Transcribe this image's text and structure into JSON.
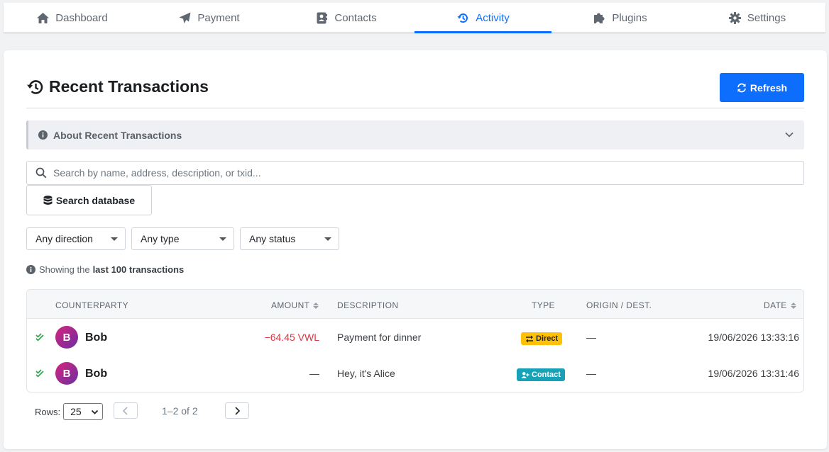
{
  "nav": {
    "tabs": [
      {
        "label": "Dashboard",
        "icon": "home-icon"
      },
      {
        "label": "Payment",
        "icon": "paper-plane-icon"
      },
      {
        "label": "Contacts",
        "icon": "address-book-icon"
      },
      {
        "label": "Activity",
        "icon": "history-icon",
        "active": true
      },
      {
        "label": "Plugins",
        "icon": "puzzle-icon"
      },
      {
        "label": "Settings",
        "icon": "gear-icon"
      }
    ]
  },
  "page": {
    "title": "Recent Transactions",
    "refresh_label": "Refresh",
    "about_label": "About Recent Transactions",
    "search_placeholder": "Search by name, address, description, or txid...",
    "search_db_label": "Search database",
    "filters": {
      "direction": "Any direction",
      "type": "Any type",
      "status": "Any status"
    },
    "showing_prefix": "Showing the",
    "showing_bold": "last 100 transactions"
  },
  "table": {
    "headers": {
      "counterparty": "COUNTERPARTY",
      "amount": "AMOUNT",
      "description": "DESCRIPTION",
      "type": "TYPE",
      "origin": "ORIGIN / DEST.",
      "date": "DATE"
    },
    "rows": [
      {
        "initial": "B",
        "name": "Bob",
        "amount": "−64.45 VWL",
        "description": "Payment for dinner",
        "type": "Direct",
        "origin": "—",
        "date": "19/06/2026 13:33:16"
      },
      {
        "initial": "B",
        "name": "Bob",
        "amount": "—",
        "description": "Hey, it's Alice",
        "type": "Contact",
        "origin": "—",
        "date": "19/06/2026 13:31:46"
      }
    ]
  },
  "pager": {
    "rows_label": "Rows:",
    "rows_value": "25",
    "info": "1–2 of 2"
  },
  "colors": {
    "accent": "#0d6efd",
    "negative": "#dc3545",
    "badge_direct": "#ffc107",
    "badge_contact": "#17a2b8"
  }
}
